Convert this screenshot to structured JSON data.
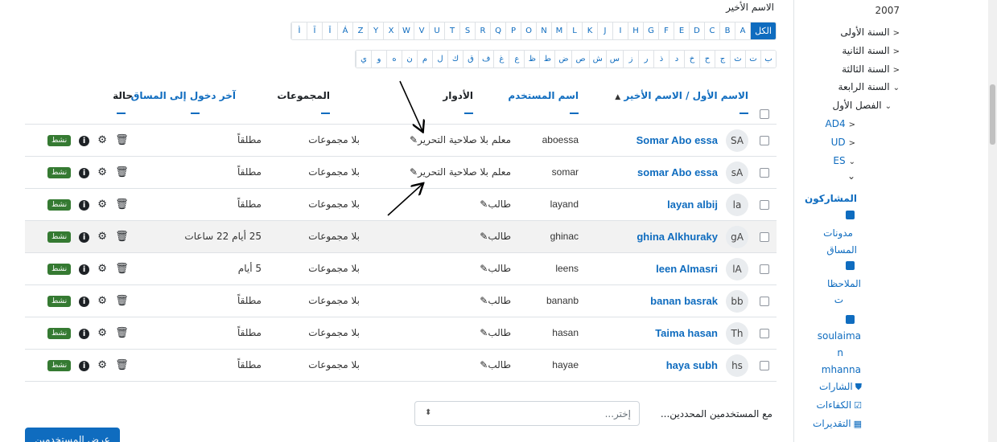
{
  "filter": {
    "lastname_label": "الاسم الأخير",
    "latin_letters": [
      "الكل",
      "A",
      "B",
      "C",
      "D",
      "E",
      "F",
      "G",
      "H",
      "I",
      "J",
      "K",
      "L",
      "M",
      "N",
      "O",
      "P",
      "Q",
      "R",
      "S",
      "T",
      "U",
      "V",
      "W",
      "X",
      "Y",
      "Z",
      "Á",
      "Ǐ",
      "Ī",
      "Ì"
    ],
    "arabic_letters": [
      "ب",
      "ت",
      "ث",
      "ج",
      "ح",
      "خ",
      "د",
      "ذ",
      "ر",
      "ز",
      "س",
      "ش",
      "ص",
      "ض",
      "ط",
      "ظ",
      "ع",
      "غ",
      "ف",
      "ق",
      "ك",
      "ل",
      "م",
      "ن",
      "ه",
      "و",
      "ي"
    ]
  },
  "table": {
    "headers": {
      "name": "الاسم الأول / الاسم الأخير",
      "name_sort": "▲",
      "username": "اسم المستخدم",
      "roles": "الأدوار",
      "groups": "المجموعات",
      "last_access": "آخر دخول إلى المساق",
      "status": "حالة"
    },
    "status_badge": "نشط",
    "rows": [
      {
        "initials": "SA",
        "name": "Somar Abo essa",
        "username": "aboessa",
        "role": "معلم بلا صلاحية التحرير",
        "group": "بلا مجموعات",
        "access": "مطلقاً"
      },
      {
        "initials": "sA",
        "name": "somar Abo essa",
        "username": "somar",
        "role": "معلم بلا صلاحية التحرير",
        "group": "بلا مجموعات",
        "access": "مطلقاً"
      },
      {
        "initials": "la",
        "name": "layan albij",
        "username": "layand",
        "role": "طالب",
        "group": "بلا مجموعات",
        "access": "مطلقاً"
      },
      {
        "initials": "gA",
        "name": "ghina Alkhuraky",
        "username": "ghinac",
        "role": "طالب",
        "group": "بلا مجموعات",
        "access": "25 أيام 22 ساعات"
      },
      {
        "initials": "lA",
        "name": "leen Almasri",
        "username": "leens",
        "role": "طالب",
        "group": "بلا مجموعات",
        "access": "5 أيام"
      },
      {
        "initials": "bb",
        "name": "banan basrak",
        "username": "bananb",
        "role": "طالب",
        "group": "بلا مجموعات",
        "access": "مطلقاً"
      },
      {
        "initials": "Th",
        "name": "Taima hasan",
        "username": "hasan",
        "role": "طالب",
        "group": "بلا مجموعات",
        "access": "مطلقاً"
      },
      {
        "initials": "hs",
        "name": "haya subh",
        "username": "hayae",
        "role": "طالب",
        "group": "بلا مجموعات",
        "access": "مطلقاً"
      }
    ]
  },
  "bulk": {
    "label": "مع المستخدمين المحددين...",
    "placeholder": "إختر..."
  },
  "add_button": "عرض المستخدمين",
  "drawer": {
    "year": "2007",
    "items": [
      "السنة الأولى",
      "السنة الثانية",
      "السنة الثالثة",
      "السنة الرابعة",
      "الفصل الأول",
      "AD4",
      "UD",
      "ES"
    ],
    "participants": "المشاركون",
    "course_blogs": [
      "مدونات",
      "المساق"
    ],
    "notes": [
      "الملاحظا",
      "ت"
    ],
    "user_name": [
      "soulaima",
      "n",
      "mhanna"
    ],
    "badges": "الشارات",
    "competencies": "الكفاءات",
    "grades": "التقديرات"
  }
}
